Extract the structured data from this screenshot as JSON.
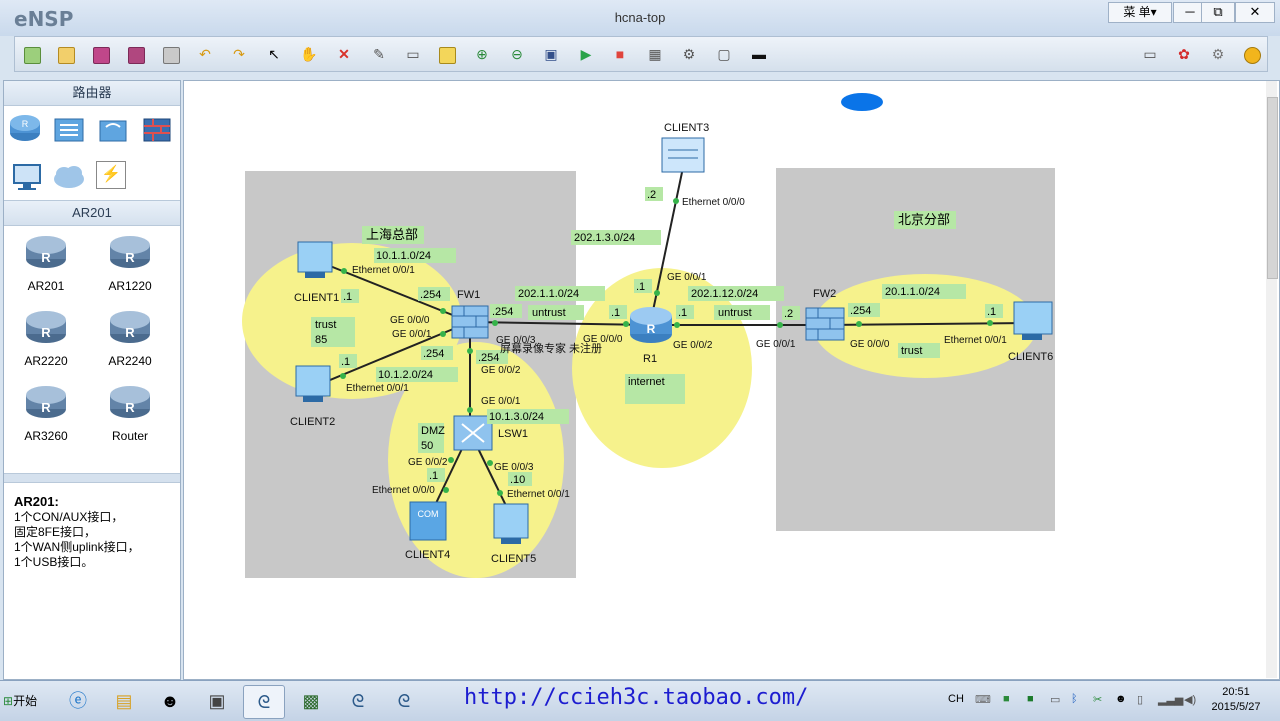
{
  "window": {
    "app_name": "eNSP",
    "title": "hcna-top",
    "menu_label": "菜 单▾",
    "minimize": "─",
    "restore": "⧉",
    "close": "✕"
  },
  "toolbar": {
    "buttons": [
      "new-topology",
      "open",
      "save",
      "save-as",
      "print",
      "undo",
      "redo",
      "select",
      "pan",
      "delete",
      "delete-link",
      "text-note",
      "shape",
      "zoom-in",
      "zoom-out",
      "fit-view",
      "start-device",
      "stop-device",
      "capture",
      "topology-settings",
      "grid",
      "console"
    ],
    "right_buttons": [
      "chat",
      "huawei",
      "settings",
      "help"
    ]
  },
  "left_panel": {
    "category_title": "路由器",
    "subcategory_title": "AR201",
    "devices": [
      {
        "label": "AR201"
      },
      {
        "label": "AR1220"
      },
      {
        "label": "AR2220"
      },
      {
        "label": "AR2240"
      },
      {
        "label": "AR3260"
      },
      {
        "label": "Router"
      }
    ],
    "info_title": "AR201:",
    "info_lines": [
      "1个CON/AUX接口，",
      "固定8FE接口，",
      "1个WAN侧uplink接口，",
      "1个USB接口。"
    ]
  },
  "topology": {
    "area_labels": {
      "shanghai": "上海总部",
      "beijing": "北京分部"
    },
    "zone_labels": {
      "trust1": "trust",
      "trust1_pri": "85",
      "dmz": "DMZ",
      "dmz_pri": "50",
      "untrust1": "untrust",
      "untrust2": "untrust",
      "internet": "internet",
      "trust2": "trust"
    },
    "nodes": {
      "client1": "CLIENT1",
      "client2": "CLIENT2",
      "client3": "CLIENT3",
      "client4": "CLIENT4",
      "client5": "CLIENT5",
      "client6": "CLIENT6",
      "fw1": "FW1",
      "fw2": "FW2",
      "r1": "R1",
      "lsw1": "LSW1"
    },
    "subnets": {
      "s1": "10.1.1.0/24",
      "s2": "10.1.2.0/24",
      "s3": "10.1.3.0/24",
      "s4": "202.1.1.0/24",
      "s5": "202.1.3.0/24",
      "s6": "202.1.12.0/24",
      "s7": "20.1.1.0/24"
    },
    "hosts": {
      "c1": ".1",
      "fw1a": ".254",
      "c2": ".1",
      "fw1b": ".254",
      "fw1c": ".254",
      "fw1d": ".254",
      "r1a": ".1",
      "r1b": ".1",
      "c3": ".2",
      "r1c": ".1",
      "fw2a": ".2",
      "fw2b": ".254",
      "c6": ".1",
      "c4": ".1",
      "c5": ".10"
    },
    "ports": {
      "p1": "Ethernet 0/0/1",
      "p2": "GE 0/0/0",
      "p3": "GE 0/0/1",
      "p4": "Ethernet 0/0/1",
      "p5": "GE 0/0/3",
      "p6": "GE 0/0/2",
      "p7": "GE 0/0/1",
      "p8": "GE 0/0/2",
      "p9": "GE 0/0/3",
      "p10": "Ethernet 0/0/0",
      "p11": "Ethernet 0/0/1",
      "p12": "GE 0/0/0",
      "p13": "GE 0/0/1",
      "p14": "GE 0/0/2",
      "p15": "Ethernet 0/0/0",
      "p16": "GE 0/0/1",
      "p17": "GE 0/0/0",
      "p18": "Ethernet 0/0/1"
    },
    "watermark": "屏幕录像专家 未注册"
  },
  "taskbar": {
    "start_label": "开始",
    "url": "http://ccieh3c.taobao.com/",
    "ime": "CH",
    "time": "20:51",
    "date": "2015/5/27"
  }
}
